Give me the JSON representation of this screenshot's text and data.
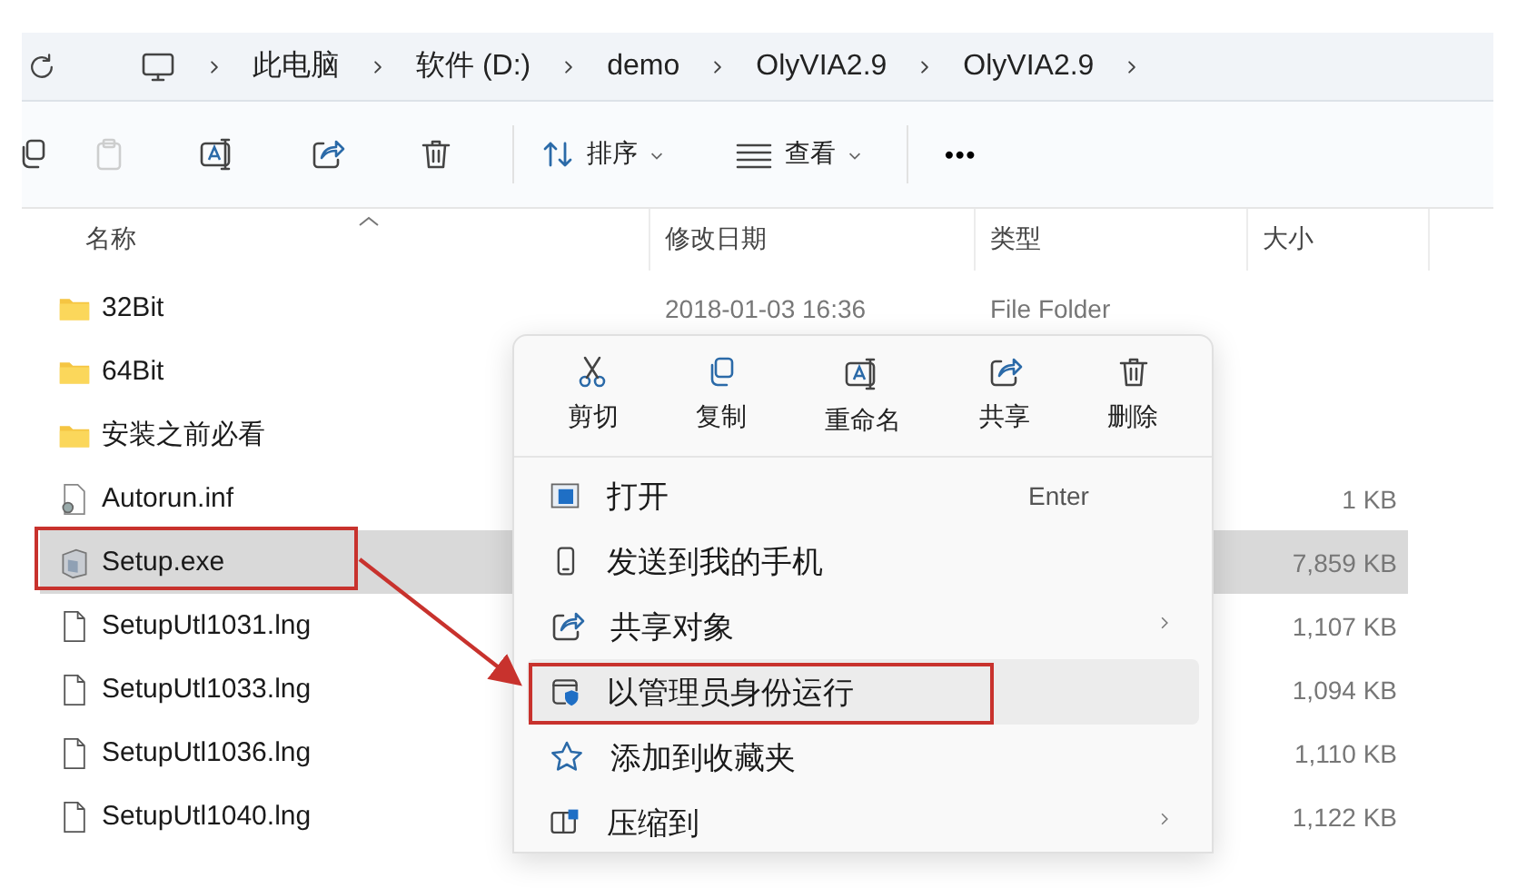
{
  "address_bar": {
    "path": [
      "此电脑",
      "软件 (D:)",
      "demo",
      "OlyVIA2.9",
      "OlyVIA2.9"
    ]
  },
  "toolbar": {
    "actions": [
      {
        "kind": "copy",
        "disabled": false
      },
      {
        "kind": "paste",
        "disabled": true
      },
      {
        "kind": "rename",
        "disabled": false
      },
      {
        "kind": "share",
        "disabled": false
      },
      {
        "kind": "delete",
        "disabled": false
      }
    ],
    "menus": [
      {
        "kind": "sort",
        "label": "排序"
      },
      {
        "kind": "view",
        "label": "查看"
      }
    ],
    "more": "•••"
  },
  "columns": [
    {
      "label": "名称",
      "sorted": true
    },
    {
      "label": "修改日期",
      "sorted": false
    },
    {
      "label": "类型",
      "sorted": false
    },
    {
      "label": "大小",
      "sorted": false
    }
  ],
  "rows": [
    {
      "kind": "folder",
      "name": "32Bit",
      "modified": "2018-01-03 16:36",
      "type": "File Folder",
      "selected": false,
      "annotated": false
    },
    {
      "kind": "folder",
      "name": "64Bit",
      "selected": false,
      "annotated": false
    },
    {
      "kind": "folder",
      "name": "安装之前必看",
      "selected": false,
      "annotated": false
    },
    {
      "kind": "config",
      "name": "Autorun.inf",
      "size": "1 KB",
      "selected": false,
      "annotated": false
    },
    {
      "kind": "installer",
      "name": "Setup.exe",
      "size": "7,859 KB",
      "selected": true,
      "annotated": true
    },
    {
      "kind": "file",
      "name": "SetupUtl1031.lng",
      "size": "1,107 KB",
      "selected": false,
      "annotated": false
    },
    {
      "kind": "file",
      "name": "SetupUtl1033.lng",
      "size": "1,094 KB",
      "selected": false,
      "annotated": false
    },
    {
      "kind": "file",
      "name": "SetupUtl1036.lng",
      "size": "1,110 KB",
      "selected": false,
      "annotated": false
    },
    {
      "kind": "file",
      "name": "SetupUtl1040.lng",
      "size": "1,122 KB",
      "selected": false,
      "annotated": false
    }
  ],
  "context_menu": {
    "quick_actions": [
      {
        "kind": "cut",
        "label": "剪切"
      },
      {
        "kind": "copy",
        "label": "复制"
      },
      {
        "kind": "rename",
        "label": "重命名"
      },
      {
        "kind": "share",
        "label": "共享"
      },
      {
        "kind": "delete",
        "label": "删除"
      }
    ],
    "items": [
      {
        "kind": "open",
        "label": "打开",
        "shortcut": "Enter",
        "submenu": false,
        "hovered": false,
        "annotated": false
      },
      {
        "kind": "phone",
        "label": "发送到我的手机",
        "submenu": false,
        "hovered": false,
        "annotated": false
      },
      {
        "kind": "share",
        "label": "共享对象",
        "submenu": true,
        "hovered": false,
        "annotated": false
      },
      {
        "kind": "admin",
        "label": "以管理员身份运行",
        "submenu": false,
        "hovered": true,
        "annotated": true
      },
      {
        "kind": "favorite",
        "label": "添加到收藏夹",
        "submenu": false,
        "hovered": false,
        "annotated": false
      },
      {
        "kind": "zip",
        "label": "压缩到",
        "submenu": true,
        "hovered": false,
        "annotated": false
      }
    ]
  },
  "annotation": {
    "arrow": true
  }
}
